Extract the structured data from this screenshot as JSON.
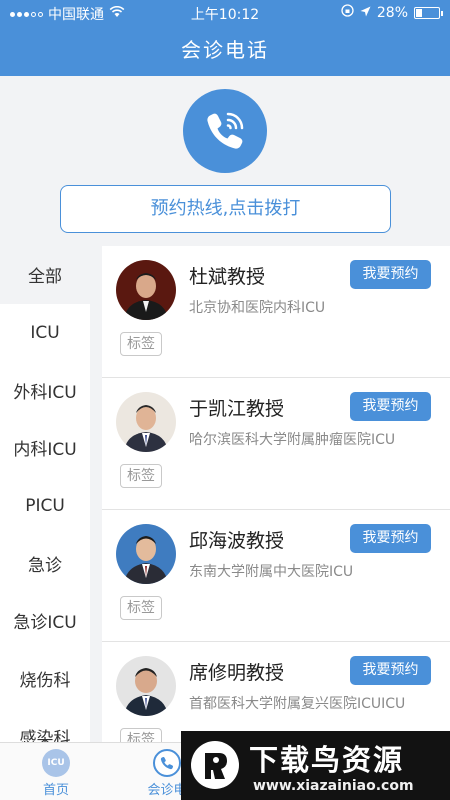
{
  "status_bar": {
    "carrier": "中国联通",
    "time": "上午10:12",
    "battery": "28%",
    "battery_level": 0.28
  },
  "header": {
    "title": "会诊电话"
  },
  "hero": {
    "hotline_label": "预约热线,点击拨打"
  },
  "sidebar": {
    "items": [
      {
        "label": "全部"
      },
      {
        "label": "ICU"
      },
      {
        "label": "外科ICU"
      },
      {
        "label": "内科ICU"
      },
      {
        "label": "PICU"
      },
      {
        "label": "急诊"
      },
      {
        "label": "急诊ICU"
      },
      {
        "label": "烧伤科"
      },
      {
        "label": "感染科"
      }
    ]
  },
  "doctors": [
    {
      "name": "杜斌教授",
      "hospital": "北京协和医院内科ICU",
      "button": "我要预约",
      "tag": "标签"
    },
    {
      "name": "于凯江教授",
      "hospital": "哈尔滨医科大学附属肿瘤医院ICU",
      "button": "我要预约",
      "tag": "标签"
    },
    {
      "name": "邱海波教授",
      "hospital": "东南大学附属中大医院ICU",
      "button": "我要预约",
      "tag": "标签"
    },
    {
      "name": "席修明教授",
      "hospital": "首都医科大学附属复兴医院ICUICU",
      "button": "我要预约",
      "tag": "标签"
    }
  ],
  "tabbar": {
    "tabs": [
      {
        "label": "首页",
        "icon_text": "ICU"
      },
      {
        "label": "会诊电"
      }
    ]
  },
  "watermark": {
    "title": "下载鸟资源",
    "url": "www.xiazainiao.com"
  },
  "colors": {
    "primary": "#4a90d9",
    "background": "#f2f3f5"
  }
}
